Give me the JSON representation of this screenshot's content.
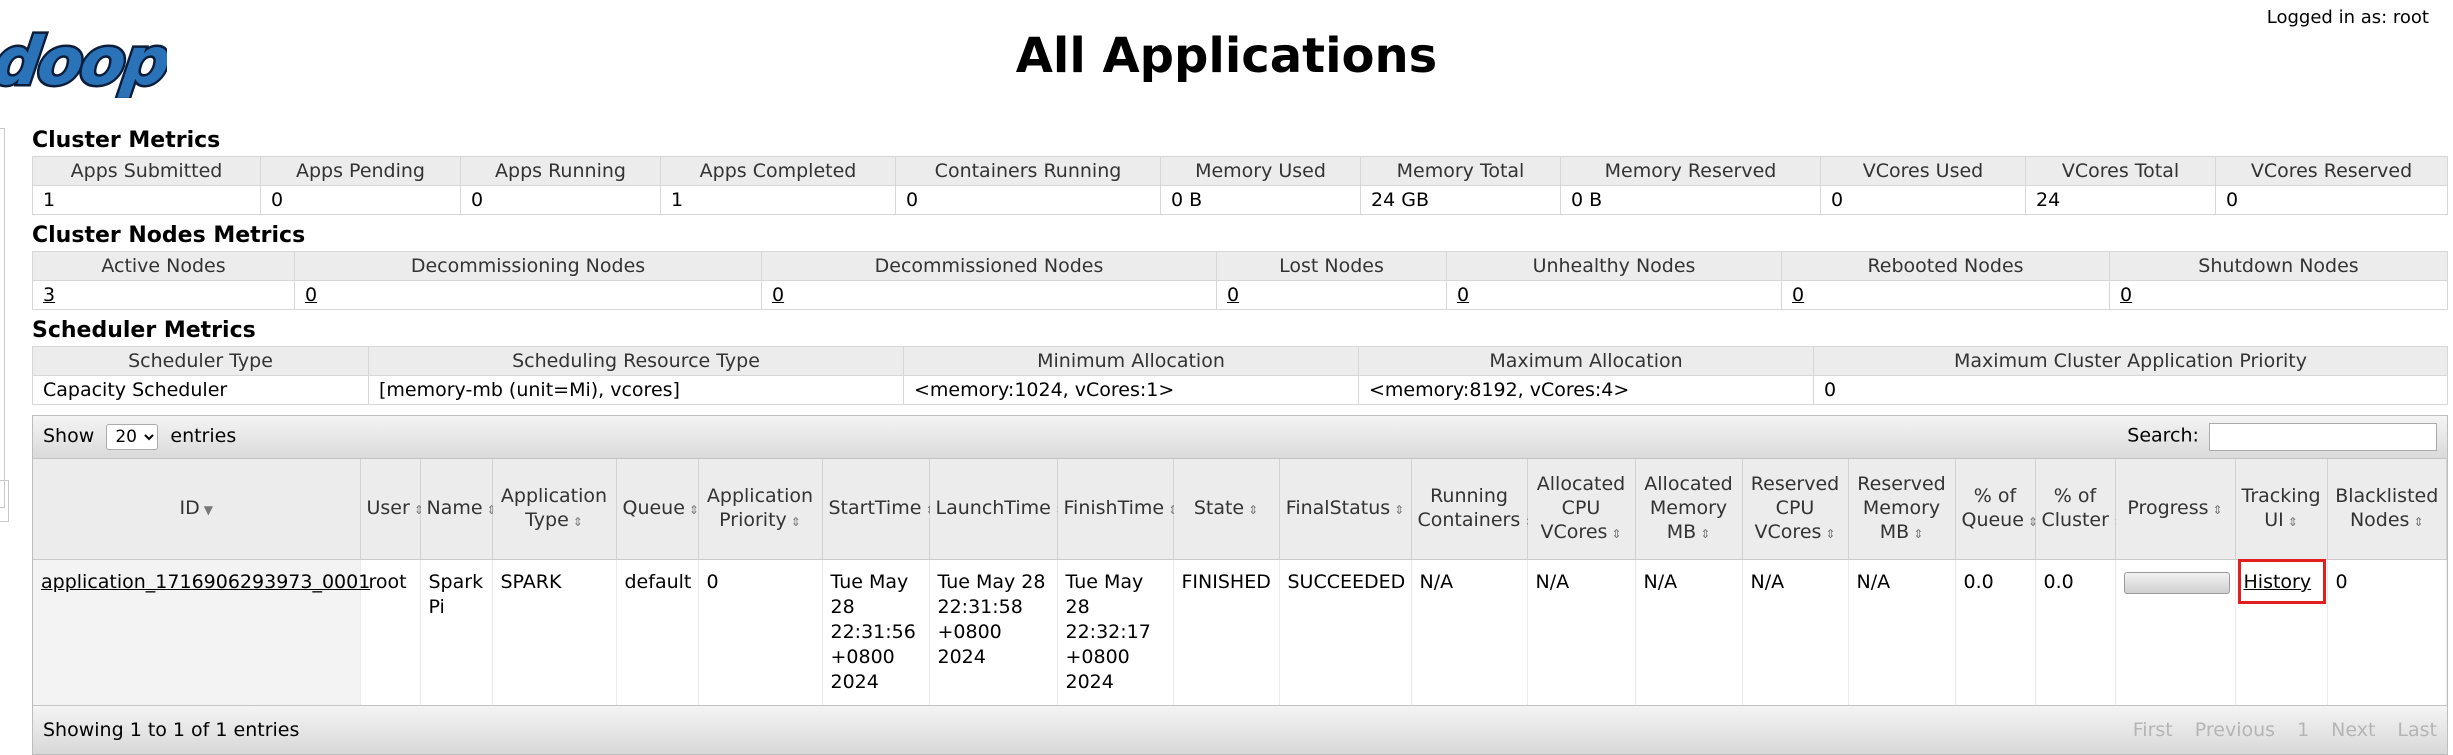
{
  "header": {
    "logo_text": "doop",
    "logged_in": "Logged in as: root",
    "title": "All Applications"
  },
  "cluster_metrics": {
    "title": "Cluster Metrics",
    "headers": [
      "Apps Submitted",
      "Apps Pending",
      "Apps Running",
      "Apps Completed",
      "Containers Running",
      "Memory Used",
      "Memory Total",
      "Memory Reserved",
      "VCores Used",
      "VCores Total",
      "VCores Reserved"
    ],
    "values": [
      "1",
      "0",
      "0",
      "1",
      "0",
      "0 B",
      "24 GB",
      "0 B",
      "0",
      "24",
      "0"
    ]
  },
  "nodes_metrics": {
    "title": "Cluster Nodes Metrics",
    "headers": [
      "Active Nodes",
      "Decommissioning Nodes",
      "Decommissioned Nodes",
      "Lost Nodes",
      "Unhealthy Nodes",
      "Rebooted Nodes",
      "Shutdown Nodes"
    ],
    "values": [
      "3",
      "0",
      "0",
      "0",
      "0",
      "0",
      "0"
    ]
  },
  "scheduler_metrics": {
    "title": "Scheduler Metrics",
    "headers": [
      "Scheduler Type",
      "Scheduling Resource Type",
      "Minimum Allocation",
      "Maximum Allocation",
      "Maximum Cluster Application Priority"
    ],
    "values": [
      "Capacity Scheduler",
      "[memory-mb (unit=Mi), vcores]",
      "<memory:1024, vCores:1>",
      "<memory:8192, vCores:4>",
      "0"
    ]
  },
  "apps": {
    "show_label": "Show",
    "show_value": "20",
    "entries_label": "entries",
    "search_label": "Search:",
    "search_value": "",
    "columns": {
      "id": "ID",
      "user": "User",
      "name": "Name",
      "app_type": "Application Type",
      "queue": "Queue",
      "priority": "Application Priority",
      "start": "StartTime",
      "launch": "LaunchTime",
      "finish": "FinishTime",
      "state": "State",
      "final_status": "FinalStatus",
      "running_containers": "Running Containers",
      "alloc_cpu": "Allocated CPU VCores",
      "alloc_mem": "Allocated Memory MB",
      "reserved_cpu": "Reserved CPU VCores",
      "reserved_mem": "Reserved Memory MB",
      "pct_queue": "% of Queue",
      "pct_cluster": "% of Cluster",
      "progress": "Progress",
      "tracking": "Tracking UI",
      "blacklisted": "Blacklisted Nodes"
    },
    "row": {
      "id": "application_1716906293973_0001",
      "user": "root",
      "name": "Spark Pi",
      "app_type": "SPARK",
      "queue": "default",
      "priority": "0",
      "start": "Tue May 28 22:31:56 +0800 2024",
      "launch": "Tue May 28 22:31:58 +0800 2024",
      "finish": "Tue May 28 22:32:17 +0800 2024",
      "state": "FINISHED",
      "final_status": "SUCCEEDED",
      "running_containers": "N/A",
      "alloc_cpu": "N/A",
      "alloc_mem": "N/A",
      "reserved_cpu": "N/A",
      "reserved_mem": "N/A",
      "pct_queue": "0.0",
      "pct_cluster": "0.0",
      "progress_fraction": 0.0,
      "tracking": "History",
      "blacklisted": "0"
    },
    "footer": {
      "info": "Showing 1 to 1 of 1 entries",
      "first": "First",
      "previous": "Previous",
      "page": "1",
      "next": "Next",
      "last": "Last"
    }
  }
}
